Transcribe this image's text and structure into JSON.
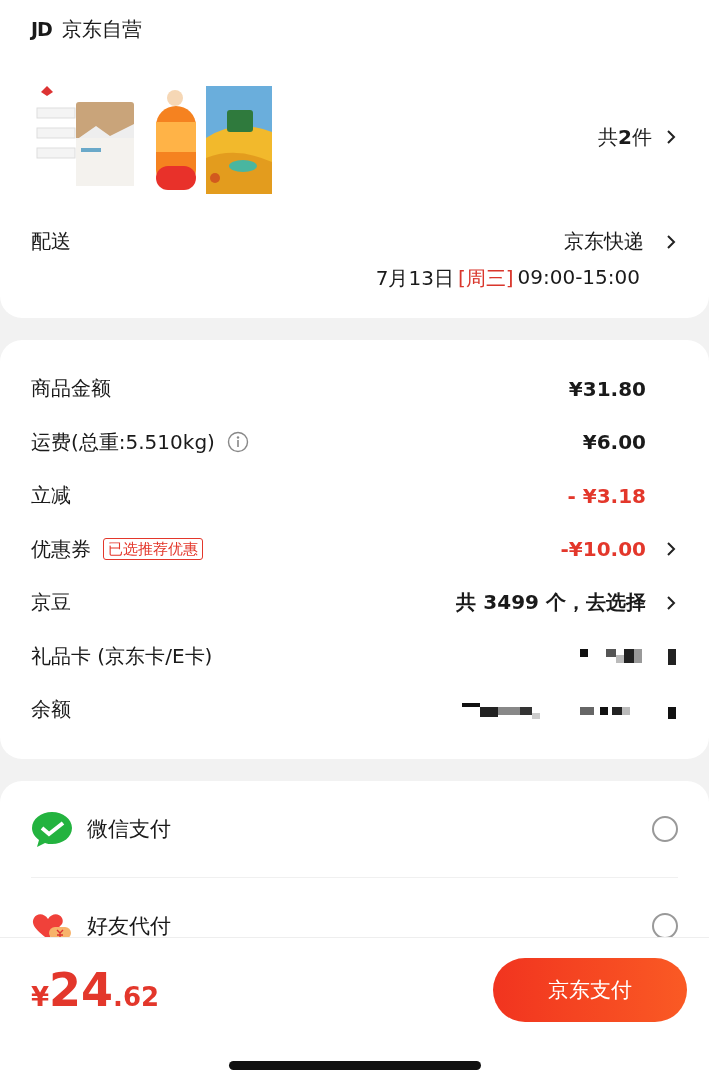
{
  "store": {
    "logo": "JD",
    "name": "京东自营"
  },
  "item_count": "共**2**件",
  "delivery": {
    "label": "配送",
    "carrier": "京东快递",
    "date": "7月13日",
    "weekday": "[周三]",
    "time": "09:00-15:00"
  },
  "summary": [
    {
      "label": "商品金额",
      "value": "¥31.80",
      "highlight": false,
      "chevron": false
    },
    {
      "label": "运费(总重:5.510kg)",
      "info": true,
      "value": "¥6.00",
      "highlight": false,
      "chevron": false
    },
    {
      "label": "立减",
      "value": "- ¥3.18",
      "highlight": true,
      "chevron": false
    },
    {
      "label": "优惠券",
      "tag": "已选推荐优惠",
      "value": "-¥10.00",
      "highlight": true,
      "chevron": true
    },
    {
      "label": "京豆",
      "value": "共 **3499** 个，去选择",
      "highlight": false,
      "chevron": true
    },
    {
      "label": "礼品卡 (京东卡/E卡)",
      "masked": true
    },
    {
      "label": "余额",
      "masked": true
    }
  ],
  "payments": [
    {
      "name": "微信支付",
      "kind": "wechat",
      "selected": false
    },
    {
      "name": "好友代付",
      "kind": "friend",
      "selected": false
    }
  ],
  "footer": {
    "currency": "¥",
    "amount_int": "24",
    "amount_dec": ".62",
    "pay_button": "京东支付"
  }
}
